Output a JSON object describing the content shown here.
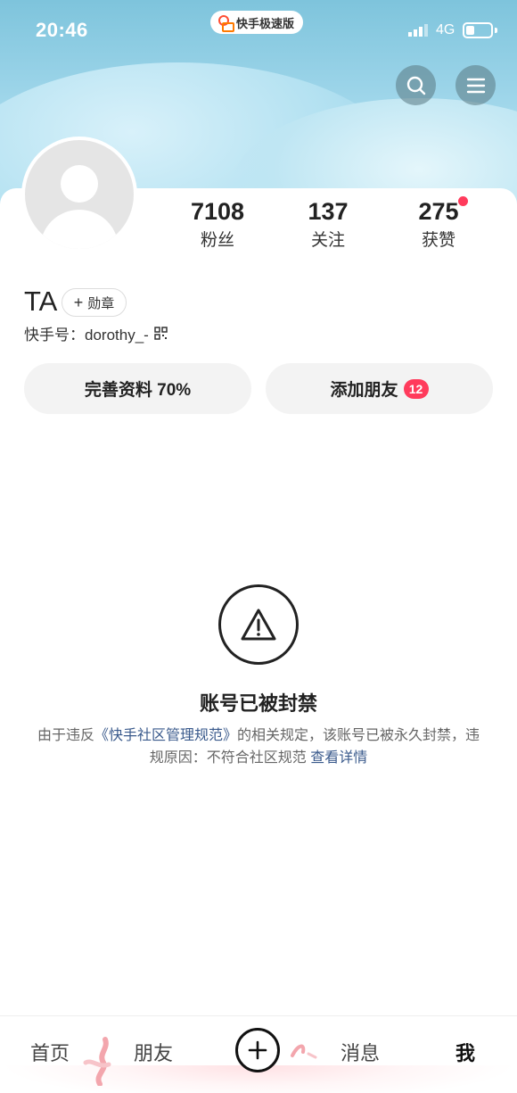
{
  "status_bar": {
    "time": "20:46",
    "app_pill_label": "快手极速版",
    "network": "4G"
  },
  "header": {
    "search_icon": "search-icon",
    "menu_icon": "menu-icon"
  },
  "profile": {
    "stats": [
      {
        "value": "7108",
        "label": "粉丝"
      },
      {
        "value": "137",
        "label": "关注"
      },
      {
        "value": "275",
        "label": "获赞"
      }
    ],
    "name": "TA",
    "badge_label": "勋章",
    "uid_label": "快手号：dorothy_-"
  },
  "actions": {
    "complete_profile": "完善资料 70%",
    "add_friends": "添加朋友",
    "add_friends_count": "12"
  },
  "banned": {
    "title": "账号已被封禁",
    "desc_prefix": "由于违反",
    "desc_link": "《快手社区管理规范》",
    "desc_middle": "的相关规定，该账号已被永久封禁，违规原因：不符合社区规范 ",
    "details_link": "查看详情"
  },
  "tabbar": {
    "home": "首页",
    "friends": "朋友",
    "messages": "消息",
    "me": "我"
  },
  "colors": {
    "accent_red": "#ff3b5c",
    "link_blue": "#3a5a8c"
  }
}
